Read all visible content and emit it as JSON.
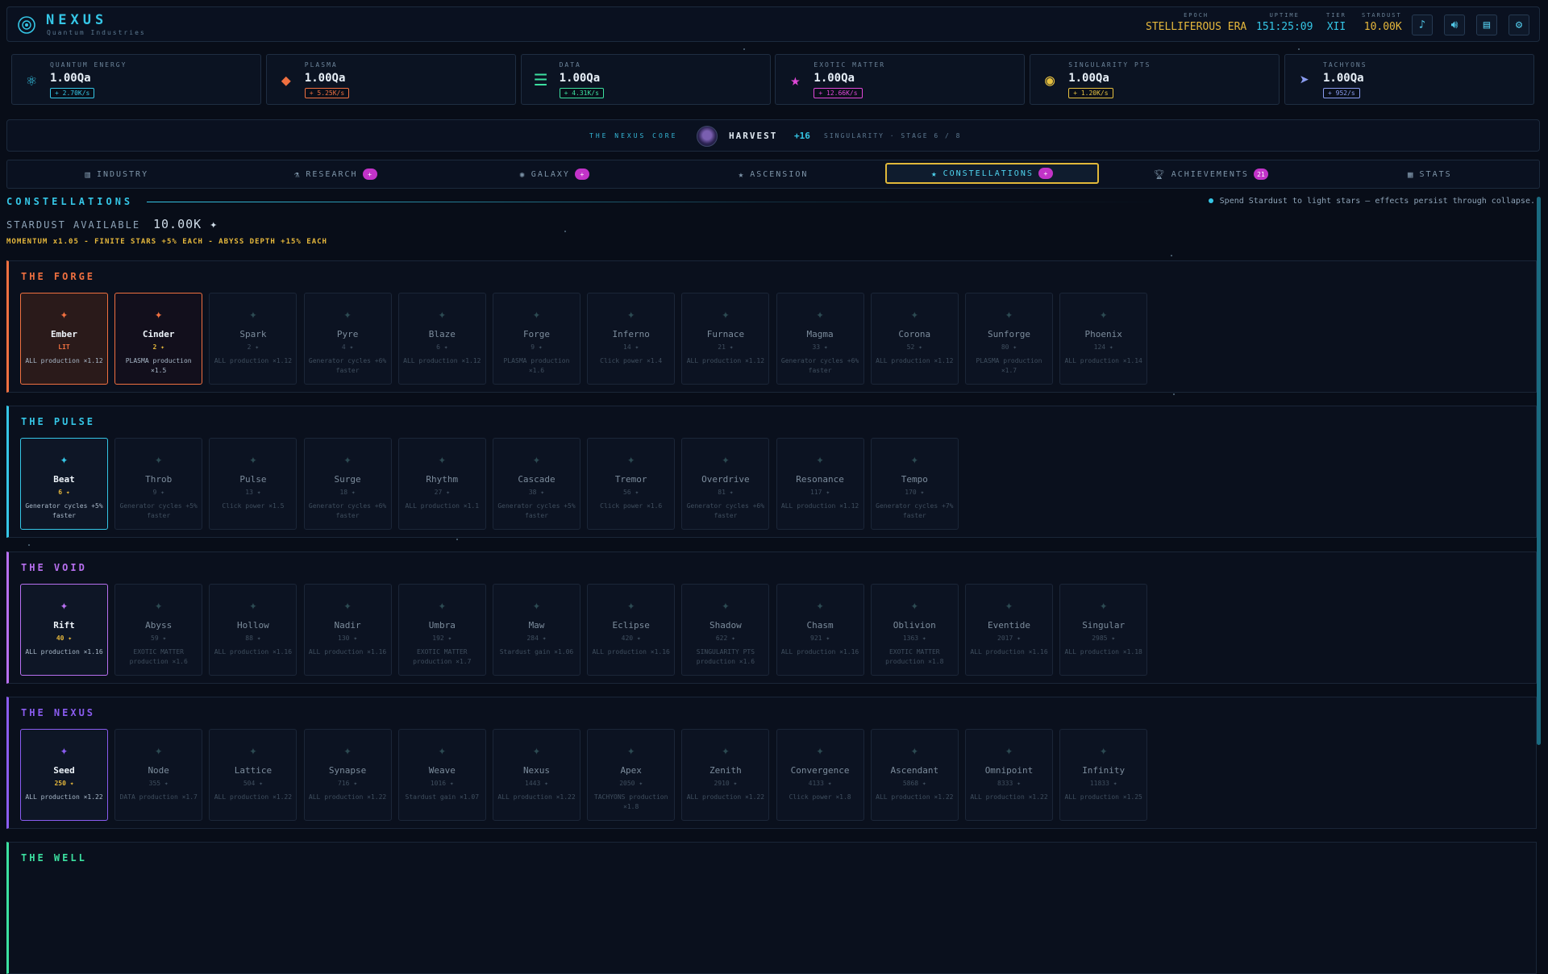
{
  "header": {
    "brand": "NEXUS",
    "subtitle": "Quantum Industries",
    "epoch_label": "EPOCH",
    "epoch_value": "STELLIFEROUS ERA",
    "uptime_label": "UPTIME",
    "uptime_value": "151:25:09",
    "tier_label": "TIER",
    "tier_value": "XII",
    "stardust_label": "STARDUST",
    "stardust_value": "10.00K",
    "icons": [
      "music-icon",
      "volume-icon",
      "log-icon",
      "settings-icon"
    ]
  },
  "resources": [
    {
      "label": "QUANTUM ENERGY",
      "value": "1.00Qa",
      "rate": "+ 2.70K/s",
      "color": "#35c6e6",
      "icon": "atom-icon"
    },
    {
      "label": "PLASMA",
      "value": "1.00Qa",
      "rate": "+ 5.25K/s",
      "color": "#f07040",
      "icon": "flame-icon"
    },
    {
      "label": "DATA",
      "value": "1.00Qa",
      "rate": "+ 4.31K/s",
      "color": "#3ce0a0",
      "icon": "data-icon"
    },
    {
      "label": "EXOTIC MATTER",
      "value": "1.00Qa",
      "rate": "+ 12.66K/s",
      "color": "#e048d8",
      "icon": "star-icon"
    },
    {
      "label": "SINGULARITY PTS",
      "value": "1.00Qa",
      "rate": "+ 1.20K/s",
      "color": "#e6c040",
      "icon": "singularity-icon"
    },
    {
      "label": "TACHYONS",
      "value": "1.00Qa",
      "rate": "+ 952/s",
      "color": "#8a9cf0",
      "icon": "tachyon-icon"
    }
  ],
  "core": {
    "label": "THE NEXUS CORE",
    "action": "HARVEST",
    "gain": "+16",
    "stage": "SINGULARITY · STAGE 6 / 8"
  },
  "tabs": [
    {
      "label": "INDUSTRY",
      "icon": "chart-icon",
      "badge": ""
    },
    {
      "label": "RESEARCH",
      "icon": "flask-icon",
      "badge": "+"
    },
    {
      "label": "GALAXY",
      "icon": "galaxy-icon",
      "badge": "+"
    },
    {
      "label": "ASCENSION",
      "icon": "star-icon",
      "badge": ""
    },
    {
      "label": "CONSTELLATIONS",
      "icon": "star-icon",
      "badge": "+",
      "active": true
    },
    {
      "label": "ACHIEVEMENTS",
      "icon": "trophy-icon",
      "badge": "21"
    },
    {
      "label": "STATS",
      "icon": "stats-icon",
      "badge": ""
    }
  ],
  "constellations": {
    "title": "CONSTELLATIONS",
    "hint": "Spend Stardust to light stars — effects persist through collapse.",
    "stardust_label": "STARDUST AVAILABLE",
    "stardust_value": "10.00K ✦",
    "momentum": "MOMENTUM x1.05 - FINITE STARS +5% EACH - ABYSS DEPTH +15% EACH",
    "groups": [
      {
        "name": "THE FORGE",
        "color": "#f07040",
        "stars": [
          {
            "name": "Ember",
            "cost": "LIT",
            "effect": "ALL production ×1.12",
            "state": "lit"
          },
          {
            "name": "Cinder",
            "cost": "2 ✦",
            "effect": "PLASMA production ×1.5",
            "state": "available"
          },
          {
            "name": "Spark",
            "cost": "2 ✦",
            "effect": "ALL production ×1.12",
            "state": "locked"
          },
          {
            "name": "Pyre",
            "cost": "4 ✦",
            "effect": "Generator cycles +6% faster",
            "state": "locked"
          },
          {
            "name": "Blaze",
            "cost": "6 ✦",
            "effect": "ALL production ×1.12",
            "state": "locked"
          },
          {
            "name": "Forge",
            "cost": "9 ✦",
            "effect": "PLASMA production ×1.6",
            "state": "locked"
          },
          {
            "name": "Inferno",
            "cost": "14 ✦",
            "effect": "Click power ×1.4",
            "state": "locked"
          },
          {
            "name": "Furnace",
            "cost": "21 ✦",
            "effect": "ALL production ×1.12",
            "state": "locked"
          },
          {
            "name": "Magma",
            "cost": "33 ✦",
            "effect": "Generator cycles +6% faster",
            "state": "locked"
          },
          {
            "name": "Corona",
            "cost": "52 ✦",
            "effect": "ALL production ×1.12",
            "state": "locked"
          },
          {
            "name": "Sunforge",
            "cost": "80 ✦",
            "effect": "PLASMA production ×1.7",
            "state": "locked"
          },
          {
            "name": "Phoenix",
            "cost": "124 ✦",
            "effect": "ALL production ×1.14",
            "state": "locked"
          }
        ]
      },
      {
        "name": "THE PULSE",
        "color": "#35c6e6",
        "stars": [
          {
            "name": "Beat",
            "cost": "6 ✦",
            "effect": "Generator cycles +5% faster",
            "state": "lit"
          },
          {
            "name": "Throb",
            "cost": "9 ✦",
            "effect": "Generator cycles +5% faster",
            "state": "locked"
          },
          {
            "name": "Pulse",
            "cost": "13 ✦",
            "effect": "Click power ×1.5",
            "state": "locked"
          },
          {
            "name": "Surge",
            "cost": "18 ✦",
            "effect": "Generator cycles +6% faster",
            "state": "locked"
          },
          {
            "name": "Rhythm",
            "cost": "27 ✦",
            "effect": "ALL production ×1.1",
            "state": "locked"
          },
          {
            "name": "Cascade",
            "cost": "38 ✦",
            "effect": "Generator cycles +5% faster",
            "state": "locked"
          },
          {
            "name": "Tremor",
            "cost": "56 ✦",
            "effect": "Click power ×1.6",
            "state": "locked"
          },
          {
            "name": "Overdrive",
            "cost": "81 ✦",
            "effect": "Generator cycles +6% faster",
            "state": "locked"
          },
          {
            "name": "Resonance",
            "cost": "117 ✦",
            "effect": "ALL production ×1.12",
            "state": "locked"
          },
          {
            "name": "Tempo",
            "cost": "170 ✦",
            "effect": "Generator cycles +7% faster",
            "state": "locked"
          }
        ]
      },
      {
        "name": "THE VOID",
        "color": "#b870f0",
        "stars": [
          {
            "name": "Rift",
            "cost": "40 ✦",
            "effect": "ALL production ×1.16",
            "state": "lit"
          },
          {
            "name": "Abyss",
            "cost": "59 ✦",
            "effect": "EXOTIC MATTER production ×1.6",
            "state": "locked"
          },
          {
            "name": "Hollow",
            "cost": "88 ✦",
            "effect": "ALL production ×1.16",
            "state": "locked"
          },
          {
            "name": "Nadir",
            "cost": "130 ✦",
            "effect": "ALL production ×1.16",
            "state": "locked"
          },
          {
            "name": "Umbra",
            "cost": "192 ✦",
            "effect": "EXOTIC MATTER production ×1.7",
            "state": "locked"
          },
          {
            "name": "Maw",
            "cost": "284 ✦",
            "effect": "Stardust gain ×1.06",
            "state": "locked"
          },
          {
            "name": "Eclipse",
            "cost": "420 ✦",
            "effect": "ALL production ×1.16",
            "state": "locked"
          },
          {
            "name": "Shadow",
            "cost": "622 ✦",
            "effect": "SINGULARITY PTS production ×1.6",
            "state": "locked"
          },
          {
            "name": "Chasm",
            "cost": "921 ✦",
            "effect": "ALL production ×1.16",
            "state": "locked"
          },
          {
            "name": "Oblivion",
            "cost": "1363 ✦",
            "effect": "EXOTIC MATTER production ×1.8",
            "state": "locked"
          },
          {
            "name": "Eventide",
            "cost": "2017 ✦",
            "effect": "ALL production ×1.16",
            "state": "locked"
          },
          {
            "name": "Singular",
            "cost": "2985 ✦",
            "effect": "ALL production ×1.18",
            "state": "locked"
          }
        ]
      },
      {
        "name": "THE NEXUS",
        "color": "#8a5cf0",
        "stars": [
          {
            "name": "Seed",
            "cost": "250 ✦",
            "effect": "ALL production ×1.22",
            "state": "lit"
          },
          {
            "name": "Node",
            "cost": "355 ✦",
            "effect": "DATA production ×1.7",
            "state": "locked"
          },
          {
            "name": "Lattice",
            "cost": "504 ✦",
            "effect": "ALL production ×1.22",
            "state": "locked"
          },
          {
            "name": "Synapse",
            "cost": "716 ✦",
            "effect": "ALL production ×1.22",
            "state": "locked"
          },
          {
            "name": "Weave",
            "cost": "1016 ✦",
            "effect": "Stardust gain ×1.07",
            "state": "locked"
          },
          {
            "name": "Nexus",
            "cost": "1443 ✦",
            "effect": "ALL production ×1.22",
            "state": "locked"
          },
          {
            "name": "Apex",
            "cost": "2050 ✦",
            "effect": "TACHYONS production ×1.8",
            "state": "locked"
          },
          {
            "name": "Zenith",
            "cost": "2910 ✦",
            "effect": "ALL production ×1.22",
            "state": "locked"
          },
          {
            "name": "Convergence",
            "cost": "4133 ✦",
            "effect": "Click power ×1.8",
            "state": "locked"
          },
          {
            "name": "Ascendant",
            "cost": "5868 ✦",
            "effect": "ALL production ×1.22",
            "state": "locked"
          },
          {
            "name": "Omnipoint",
            "cost": "8333 ✦",
            "effect": "ALL production ×1.22",
            "state": "locked"
          },
          {
            "name": "Infinity",
            "cost": "11833 ✦",
            "effect": "ALL production ×1.25",
            "state": "locked"
          }
        ]
      },
      {
        "name": "THE WELL",
        "color": "#3ce0a0",
        "stars": []
      }
    ]
  }
}
